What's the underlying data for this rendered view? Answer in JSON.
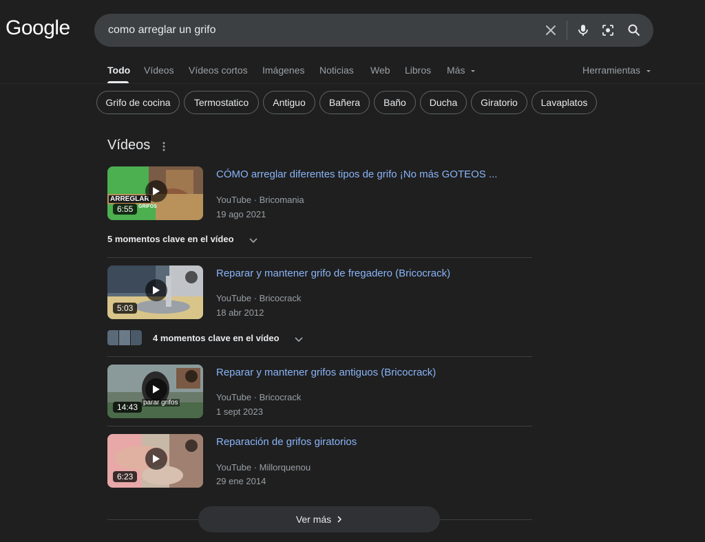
{
  "logo": "Google",
  "search": {
    "query": "como arreglar un grifo"
  },
  "tabs": [
    {
      "label": "Todo",
      "active": true
    },
    {
      "label": "Vídeos"
    },
    {
      "label": "Vídeos cortos"
    },
    {
      "label": "Imágenes"
    },
    {
      "label": "Noticias"
    },
    {
      "label": "Web"
    },
    {
      "label": "Libros"
    },
    {
      "label": "Más"
    }
  ],
  "tools": "Herramientas",
  "chips": [
    "Grifo de cocina",
    "Termostatico",
    "Antiguo",
    "Bañera",
    "Baño",
    "Ducha",
    "Giratorio",
    "Lavaplatos"
  ],
  "section_title": "Vídeos",
  "videos": [
    {
      "title": "CÓMO arreglar diferentes tipos de grifo ¡No más GOTEOS ...",
      "source": "YouTube · Bricomania",
      "date": "19 ago 2021",
      "duration": "6:55",
      "thumb_text": "ARREGLAR",
      "thumb_sub": "GRIFOS",
      "key_moments": "5 momentos clave en el vídeo"
    },
    {
      "title": "Reparar y mantener grifo de fregadero (Bricocrack)",
      "source": "YouTube · Bricocrack",
      "date": "18 abr 2012",
      "duration": "5:03",
      "key_moments": "4 momentos clave en el vídeo"
    },
    {
      "title": "Reparar y mantener grifos antiguos (Bricocrack)",
      "source": "YouTube · Bricocrack",
      "date": "1 sept 2023",
      "duration": "14:43",
      "thumb_caption": "parar grifos"
    },
    {
      "title": "Reparación de grifos giratorios",
      "source": "YouTube · Millorquenou",
      "date": "29 ene 2014",
      "duration": "6:23"
    }
  ],
  "ver_mas": "Ver más",
  "colors": {
    "background": "#1f1f1f",
    "link": "#8ab4f8",
    "meta": "#9aa0a6"
  }
}
